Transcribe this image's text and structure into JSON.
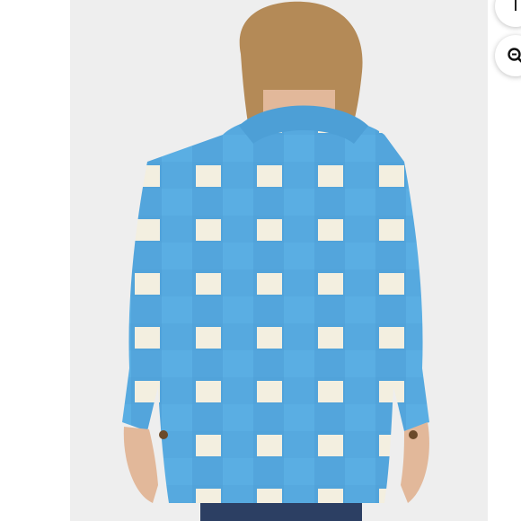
{
  "photo": {
    "subject": "",
    "background_color": "#eeeeee",
    "jacket_primary_color": "#5aaee3",
    "jacket_secondary_color": "#f3efe0",
    "hair_color": "#b48a57",
    "skin_color": "#e2b89a",
    "pants_color": "#2c3f63"
  },
  "controls": {
    "top_button_icon": "share-icon",
    "zoom_button_icon": "zoom-in-icon"
  }
}
